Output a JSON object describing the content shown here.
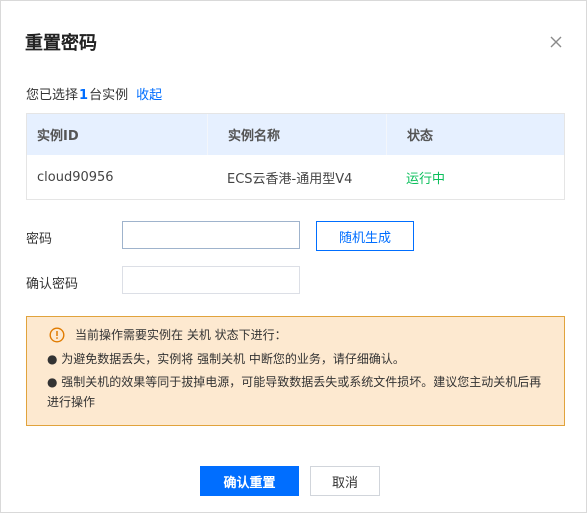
{
  "dialog": {
    "title": "重置密码",
    "close_icon": "close-icon"
  },
  "selection": {
    "prefix": "您已选择",
    "count": "1",
    "suffix": "台实例",
    "collapse_label": "收起"
  },
  "table": {
    "headers": [
      "实例ID",
      "实例名称",
      "状态"
    ],
    "rows": [
      {
        "id": "cloud90956",
        "name": "ECS云香港-通用型V4",
        "status": "运行中"
      }
    ]
  },
  "form": {
    "password_label": "密码",
    "password_value": "",
    "generate_label": "随机生成",
    "confirm_label": "确认密码",
    "confirm_value": ""
  },
  "warning": {
    "icon": "warning-circle-icon",
    "heading": "当前操作需要实例在 关机 状态下进行：",
    "lines": [
      "● 为避免数据丢失，实例将 强制关机 中断您的业务，请仔细确认。",
      "● 强制关机的效果等同于拔掉电源，可能导致数据丢失或系统文件损坏。建议您主动关机后再进行操作"
    ]
  },
  "footer": {
    "confirm_label": "确认重置",
    "cancel_label": "取消"
  },
  "colors": {
    "primary": "#006eff",
    "success": "#0abf5b",
    "warning_bg": "#fde9d0",
    "warning_border": "#e1a33c"
  }
}
